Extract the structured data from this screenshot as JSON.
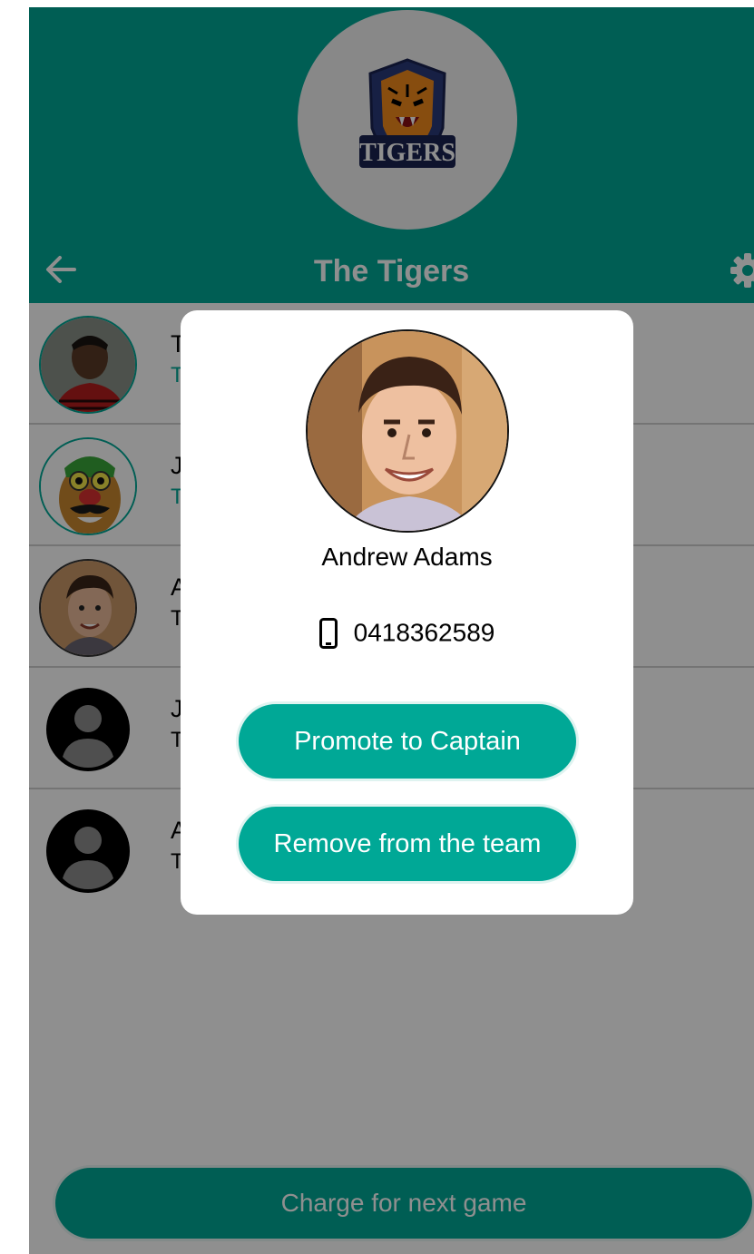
{
  "header": {
    "team_name": "The Tigers",
    "logo_text": "TIGERS",
    "back_icon": "arrow-left-icon",
    "settings_icon": "gear-icon"
  },
  "members": [
    {
      "name": "T",
      "subtitle": "T",
      "avatar": "photo",
      "subtitle_color": "#00a896"
    },
    {
      "name": "J",
      "subtitle": "T",
      "avatar": "cartoon",
      "subtitle_color": "#00a896"
    },
    {
      "name": "A",
      "subtitle": "T",
      "avatar": "photo",
      "subtitle_color": "#000000"
    },
    {
      "name": "J",
      "subtitle": "T",
      "avatar": "default-person-icon",
      "subtitle_color": "#000000"
    },
    {
      "name": "A",
      "subtitle": "T",
      "avatar": "default-person-icon",
      "subtitle_color": "#000000"
    }
  ],
  "footer": {
    "charge_label": "Charge for next game"
  },
  "modal": {
    "member_name": "Andrew Adams",
    "phone": "0418362589",
    "phone_icon": "mobile-phone-icon",
    "promote_label": "Promote to Captain",
    "remove_label": "Remove from the team"
  },
  "colors": {
    "accent": "#00a896",
    "overlay": "rgba(0,0,0,0.44)"
  }
}
